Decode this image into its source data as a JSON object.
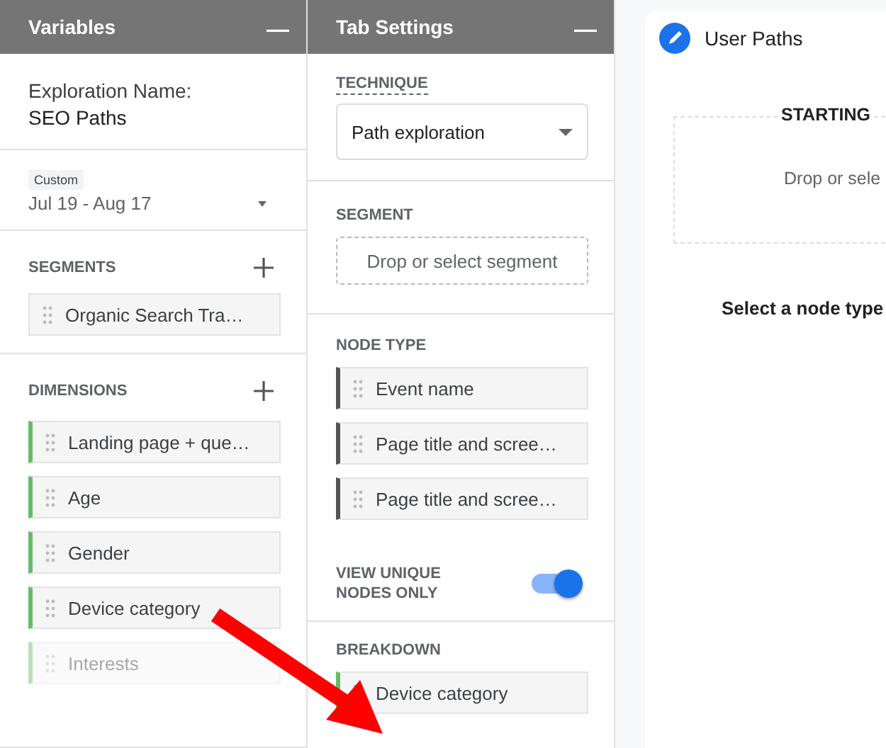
{
  "variables_panel": {
    "title": "Variables",
    "collapse_icon": "—",
    "exploration_name_label": "Exploration Name:",
    "exploration_name": "SEO Paths",
    "date_range": {
      "badge": "Custom",
      "value": "Jul 19 - Aug 17"
    },
    "segments": {
      "heading": "SEGMENTS",
      "items": [
        {
          "label": "Organic Search Tra…",
          "dimmed": false
        }
      ]
    },
    "dimensions": {
      "heading": "DIMENSIONS",
      "items": [
        {
          "label": "Landing page + que…",
          "dimmed": false
        },
        {
          "label": "Age",
          "dimmed": false
        },
        {
          "label": "Gender",
          "dimmed": false
        },
        {
          "label": "Device category",
          "dimmed": false
        },
        {
          "label": "Interests",
          "dimmed": true
        }
      ]
    }
  },
  "tab_settings_panel": {
    "title": "Tab Settings",
    "collapse_icon": "—",
    "technique": {
      "label": "TECHNIQUE",
      "value": "Path exploration"
    },
    "segment": {
      "label": "SEGMENT",
      "placeholder": "Drop or select segment"
    },
    "node_type": {
      "label": "NODE TYPE",
      "items": [
        {
          "label": "Event name",
          "dimmed": false
        },
        {
          "label": "Page title and scree…",
          "dimmed": false
        },
        {
          "label": "Page title and scree…",
          "dimmed": false
        }
      ]
    },
    "view_unique_nodes": {
      "label": "VIEW UNIQUE NODES ONLY",
      "on": true
    },
    "breakdown": {
      "label": "BREAKDOWN",
      "items": [
        {
          "label": "Device category",
          "dimmed": false
        }
      ]
    }
  },
  "canvas": {
    "tab": {
      "title": "User Paths"
    },
    "starting_point": {
      "heading": "STARTING",
      "hint": "Drop or sele"
    },
    "message": "Select a node type"
  }
}
